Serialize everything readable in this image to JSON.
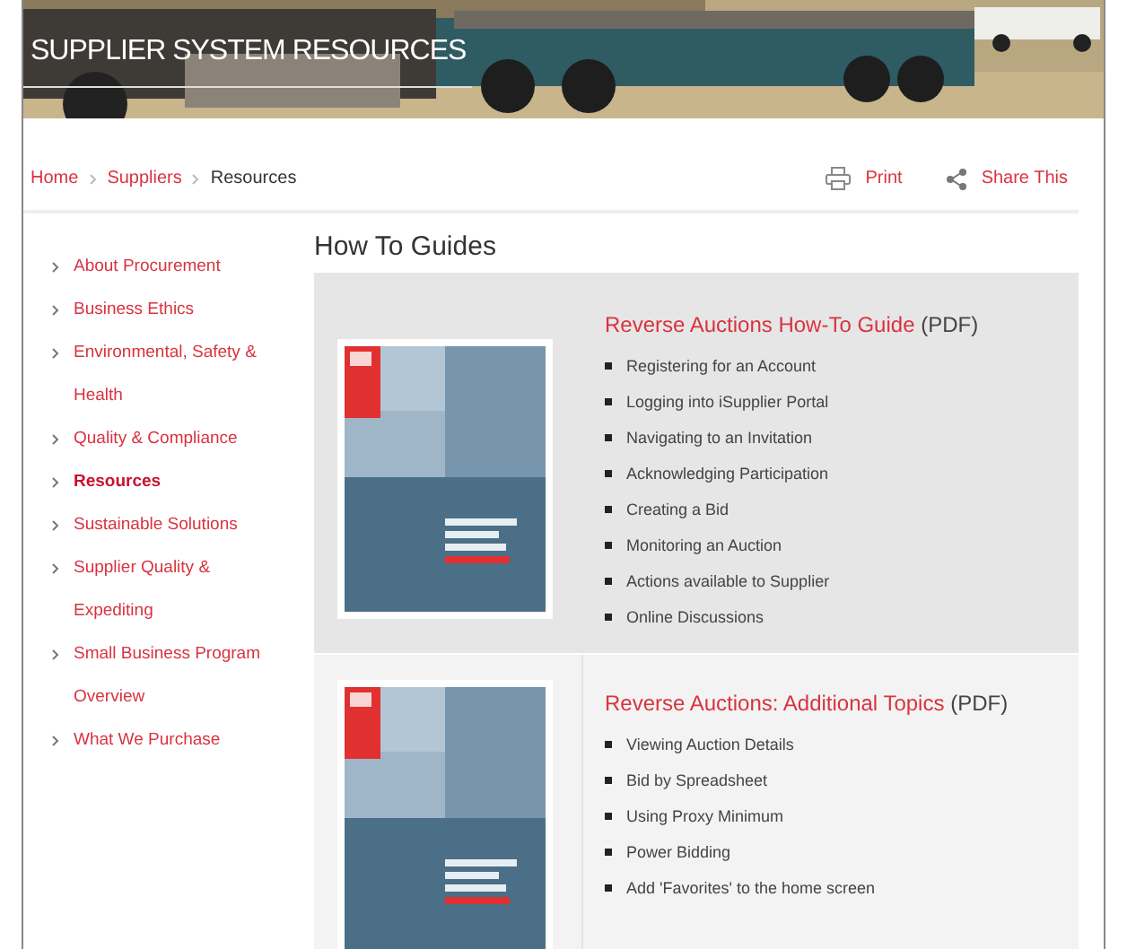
{
  "banner": {
    "title": "SUPPLIER SYSTEM RESOURCES"
  },
  "breadcrumb": [
    {
      "label": "Home",
      "current": false
    },
    {
      "label": "Suppliers",
      "current": false
    },
    {
      "label": "Resources",
      "current": true
    }
  ],
  "actions": [
    {
      "kind": "print",
      "label": "Print"
    },
    {
      "kind": "share",
      "label": "Share This"
    }
  ],
  "sidebar": {
    "items": [
      {
        "label": "About Procurement",
        "selected": false
      },
      {
        "label": "Business Ethics",
        "selected": false
      },
      {
        "label": "Environmental, Safety & Health",
        "selected": false
      },
      {
        "label": "Quality & Compliance",
        "selected": false
      },
      {
        "label": "Resources",
        "selected": true
      },
      {
        "label": "Sustainable Solutions",
        "selected": false
      },
      {
        "label": "Supplier Quality & Expediting",
        "selected": false
      },
      {
        "label": "Small Business Program Overview",
        "selected": false
      },
      {
        "label": "What We Purchase",
        "selected": false
      }
    ]
  },
  "heading": "How To Guides",
  "guides": [
    {
      "title": "Reverse Auctions How-To Guide",
      "format": "(PDF)",
      "topics": [
        "Registering for an Account",
        "Logging into iSupplier Portal",
        "Navigating to an Invitation",
        "Acknowledging Participation",
        "Creating a Bid",
        "Monitoring an Auction",
        "Actions available to Supplier",
        "Online Discussions"
      ]
    },
    {
      "title": "Reverse Auctions: Additional Topics",
      "format": "(PDF)",
      "topics": [
        "Viewing Auction Details",
        "Bid by Spreadsheet",
        "Using Proxy Minimum",
        "Power Bidding",
        "Add 'Favorites' to the home screen"
      ]
    }
  ]
}
